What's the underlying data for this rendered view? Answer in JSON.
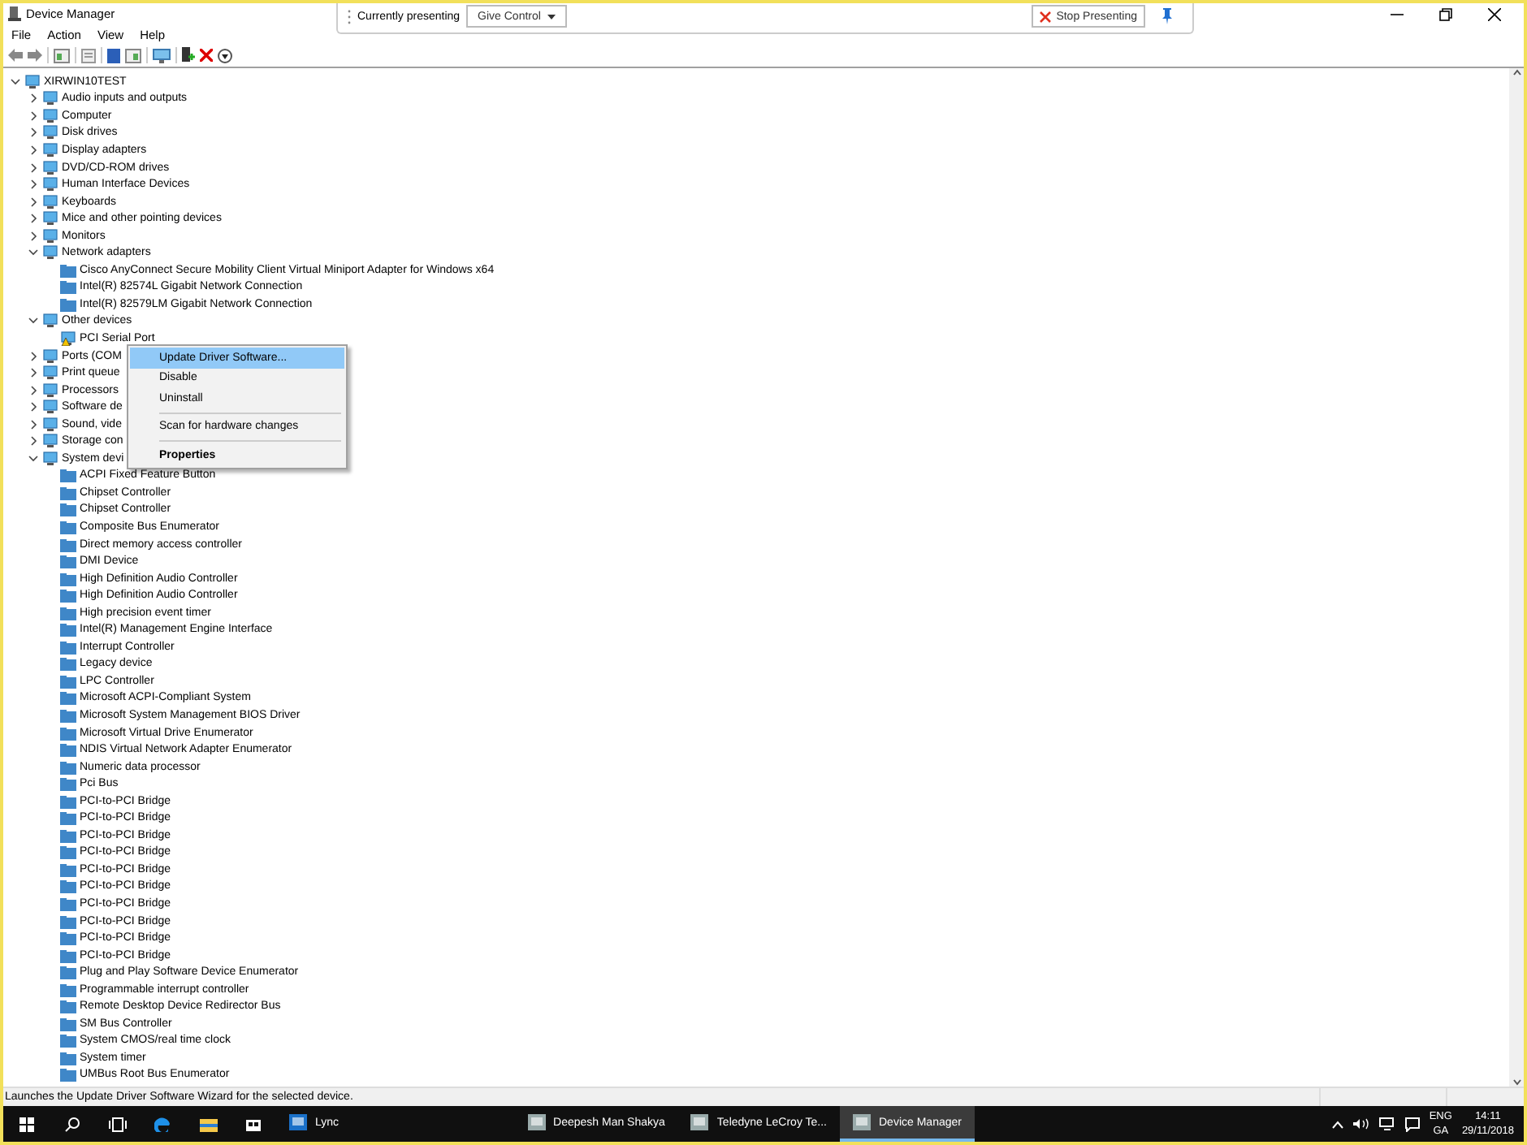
{
  "window": {
    "title": "Device Manager"
  },
  "menu": [
    "File",
    "Action",
    "View",
    "Help"
  ],
  "presenting_bar": {
    "label": "Currently presenting",
    "give_control": "Give Control",
    "stop": "Stop Presenting"
  },
  "tree": [
    {
      "label": "XIRWIN10TEST",
      "expanded": true,
      "children": [
        {
          "label": "Audio inputs and outputs",
          "expanded": false
        },
        {
          "label": "Computer",
          "expanded": false
        },
        {
          "label": "Disk drives",
          "expanded": false
        },
        {
          "label": "Display adapters",
          "expanded": false
        },
        {
          "label": "DVD/CD-ROM drives",
          "expanded": false
        },
        {
          "label": "Human Interface Devices",
          "expanded": false
        },
        {
          "label": "Keyboards",
          "expanded": false
        },
        {
          "label": "Mice and other pointing devices",
          "expanded": false
        },
        {
          "label": "Monitors",
          "expanded": false
        },
        {
          "label": "Network adapters",
          "expanded": true,
          "children": [
            {
              "label": "Cisco AnyConnect Secure Mobility Client Virtual Miniport Adapter for Windows x64"
            },
            {
              "label": "Intel(R) 82574L Gigabit Network Connection"
            },
            {
              "label": "Intel(R) 82579LM Gigabit Network Connection"
            }
          ]
        },
        {
          "label": "Other devices",
          "expanded": true,
          "children": [
            {
              "label": "PCI Serial Port",
              "warning": true
            }
          ]
        },
        {
          "label": "Ports (COM",
          "expanded": false
        },
        {
          "label": "Print queue",
          "expanded": false
        },
        {
          "label": "Processors",
          "expanded": false
        },
        {
          "label": "Software de",
          "expanded": false
        },
        {
          "label": "Sound, vide",
          "expanded": false
        },
        {
          "label": "Storage con",
          "expanded": false
        },
        {
          "label": "System devi",
          "expanded": true,
          "children": [
            {
              "label": "ACPI Fixed Feature Button"
            },
            {
              "label": "Chipset Controller"
            },
            {
              "label": "Chipset Controller"
            },
            {
              "label": "Composite Bus Enumerator"
            },
            {
              "label": "Direct memory access controller"
            },
            {
              "label": "DMI Device"
            },
            {
              "label": "High Definition Audio Controller"
            },
            {
              "label": "High Definition Audio Controller"
            },
            {
              "label": "High precision event timer"
            },
            {
              "label": "Intel(R) Management Engine Interface"
            },
            {
              "label": "Interrupt Controller"
            },
            {
              "label": "Legacy device"
            },
            {
              "label": "LPC Controller"
            },
            {
              "label": "Microsoft ACPI-Compliant System"
            },
            {
              "label": "Microsoft System Management BIOS Driver"
            },
            {
              "label": "Microsoft Virtual Drive Enumerator"
            },
            {
              "label": "NDIS Virtual Network Adapter Enumerator"
            },
            {
              "label": "Numeric data processor"
            },
            {
              "label": "Pci Bus"
            },
            {
              "label": "PCI-to-PCI Bridge"
            },
            {
              "label": "PCI-to-PCI Bridge"
            },
            {
              "label": "PCI-to-PCI Bridge"
            },
            {
              "label": "PCI-to-PCI Bridge"
            },
            {
              "label": "PCI-to-PCI Bridge"
            },
            {
              "label": "PCI-to-PCI Bridge"
            },
            {
              "label": "PCI-to-PCI Bridge"
            },
            {
              "label": "PCI-to-PCI Bridge"
            },
            {
              "label": "PCI-to-PCI Bridge"
            },
            {
              "label": "PCI-to-PCI Bridge"
            },
            {
              "label": "Plug and Play Software Device Enumerator"
            },
            {
              "label": "Programmable interrupt controller"
            },
            {
              "label": "Remote Desktop Device Redirector Bus"
            },
            {
              "label": "SM Bus Controller"
            },
            {
              "label": "System CMOS/real time clock"
            },
            {
              "label": "System timer"
            },
            {
              "label": "UMBus Root Bus Enumerator"
            }
          ]
        }
      ]
    }
  ],
  "context_menu": [
    {
      "kind": "item",
      "label": "Update Driver Software...",
      "selected": true,
      "default": false
    },
    {
      "kind": "item",
      "label": "Disable",
      "selected": false,
      "default": false
    },
    {
      "kind": "item",
      "label": "Uninstall",
      "selected": false,
      "default": false
    },
    {
      "kind": "separator"
    },
    {
      "kind": "item",
      "label": "Scan for hardware changes",
      "selected": false,
      "default": false
    },
    {
      "kind": "separator"
    },
    {
      "kind": "item",
      "label": "Properties",
      "selected": false,
      "default": true
    }
  ],
  "status_bar": "Launches the Update Driver Software Wizard for the selected device.",
  "taskbar": {
    "apps": [
      {
        "label": "Lync",
        "selected": false
      },
      {
        "label": "Deepesh Man Shakya",
        "selected": false
      },
      {
        "label": "Teledyne LeCroy Te...",
        "selected": false
      },
      {
        "label": "Device Manager",
        "selected": true
      }
    ],
    "language": "ENG",
    "layout": "GA",
    "time": "14:11",
    "date": "29/11/2018"
  }
}
